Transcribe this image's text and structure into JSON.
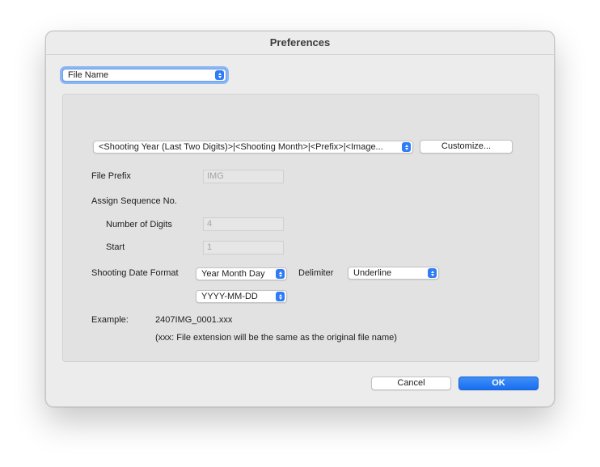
{
  "window": {
    "title": "Preferences"
  },
  "section_popup": {
    "selected": "File Name"
  },
  "pattern": {
    "selected": "<Shooting Year (Last Two Digits)>|<Shooting Month>|<Prefix>|<Image...",
    "customize_label": "Customize..."
  },
  "file_prefix": {
    "label": "File Prefix",
    "value": "IMG"
  },
  "sequence": {
    "label": "Assign Sequence No.",
    "digits_label": "Number of Digits",
    "digits_value": "4",
    "start_label": "Start",
    "start_value": "1"
  },
  "date_format": {
    "label": "Shooting Date Format",
    "order_selected": "Year Month Day",
    "delimiter_label": "Delimiter",
    "delimiter_selected": "Underline",
    "format_selected": "YYYY-MM-DD"
  },
  "example": {
    "label": "Example:",
    "value": "2407IMG_0001.xxx",
    "note": "(xxx: File extension will be the same as the original file name)"
  },
  "buttons": {
    "cancel": "Cancel",
    "ok": "OK"
  },
  "colors": {
    "accent": "#1a6ff0",
    "window_bg": "#ececec",
    "panel_bg": "#e2e2e2"
  }
}
